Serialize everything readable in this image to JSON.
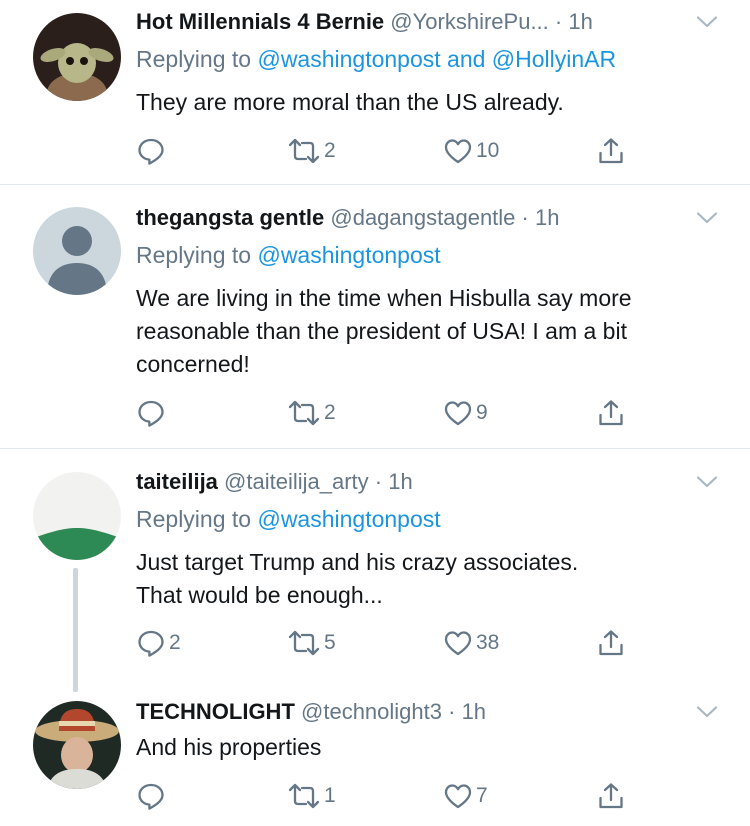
{
  "tweets": [
    {
      "name": "Hot Millennials 4 Bernie",
      "handle": "@YorkshirePu...",
      "time": "· 1h",
      "replying_prefix": "Replying to",
      "replying_to": "@washingtonpost and @HollyinAR",
      "lines": [
        "They are more moral than the US already."
      ],
      "replies": "",
      "retweets": "2",
      "likes": "10",
      "avatar_icon": "baby-yoda-avatar"
    },
    {
      "name": "thegangsta gentle",
      "handle": "@dagangstagentle",
      "time": "· 1h",
      "replying_prefix": "Replying to",
      "replying_to": "@washingtonpost",
      "lines": [
        "We are living in the time when Hisbulla say more",
        "reasonable than the president of USA! I am a bit",
        "concerned!"
      ],
      "replies": "",
      "retweets": "2",
      "likes": "9",
      "avatar_icon": "default-profile-avatar"
    },
    {
      "name": "taiteilija",
      "handle": "@taiteilija_arty",
      "time": "· 1h",
      "replying_prefix": "Replying to",
      "replying_to": "@washingtonpost",
      "lines": [
        "Just target Trump and his crazy associates.",
        "That would be enough..."
      ],
      "replies": "2",
      "retweets": "5",
      "likes": "38",
      "avatar_icon": "landscape-avatar"
    },
    {
      "name": "TECHNOLIGHT",
      "handle": "@technolight3",
      "time": "· 1h",
      "lines": [
        "And his properties"
      ],
      "replies": "",
      "retweets": "1",
      "likes": "7",
      "avatar_icon": "sombrero-person-avatar"
    }
  ],
  "colors": {
    "text": "#14171a",
    "secondary": "#657786",
    "link": "#1b95e0",
    "divider": "#e1e8ed",
    "thread_line": "#ccd6dd"
  },
  "icons": [
    "reply-icon",
    "retweet-icon",
    "like-icon",
    "share-icon",
    "chevron-down-icon"
  ]
}
